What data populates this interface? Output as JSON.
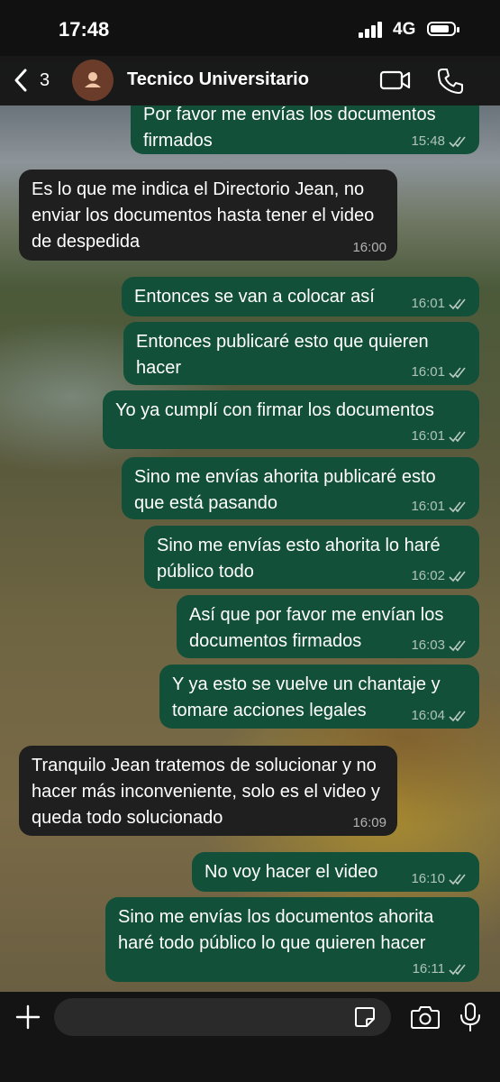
{
  "status": {
    "time": "17:48",
    "network": "4G"
  },
  "header": {
    "back_count": "3",
    "contact_name": "Tecnico Universitario"
  },
  "messages": [
    {
      "dir": "out",
      "text": "Por favor me envías los documentos firmados",
      "time": "15:48"
    },
    {
      "dir": "in",
      "text": "Es lo que me indica el Directorio Jean, no enviar los documentos hasta tener el video de despedida",
      "time": "16:00"
    },
    {
      "dir": "out",
      "text": "Entonces se van a colocar así",
      "time": "16:01"
    },
    {
      "dir": "out",
      "text": "Entonces publicaré esto que quieren hacer",
      "time": "16:01"
    },
    {
      "dir": "out",
      "text": "Yo ya cumplí con firmar los documentos",
      "time": "16:01"
    },
    {
      "dir": "out",
      "text": "Sino me envías ahorita publicaré esto que está pasando",
      "time": "16:01"
    },
    {
      "dir": "out",
      "text": "Sino me envías esto ahorita lo haré público todo",
      "time": "16:02"
    },
    {
      "dir": "out",
      "text": "Así que por favor me envían los documentos firmados",
      "time": "16:03"
    },
    {
      "dir": "out",
      "text": "Y ya esto se vuelve un chantaje y tomare acciones legales",
      "time": "16:04"
    },
    {
      "dir": "in",
      "text": "Tranquilo Jean tratemos de solucionar y no hacer más inconveniente, solo es el video y queda todo solucionado",
      "time": "16:09"
    },
    {
      "dir": "out",
      "text": "No voy hacer el video",
      "time": "16:10"
    },
    {
      "dir": "out",
      "text": "Sino me envías los documentos ahorita haré todo público lo que quieren hacer",
      "time": "16:11"
    }
  ],
  "input": {
    "placeholder": ""
  }
}
